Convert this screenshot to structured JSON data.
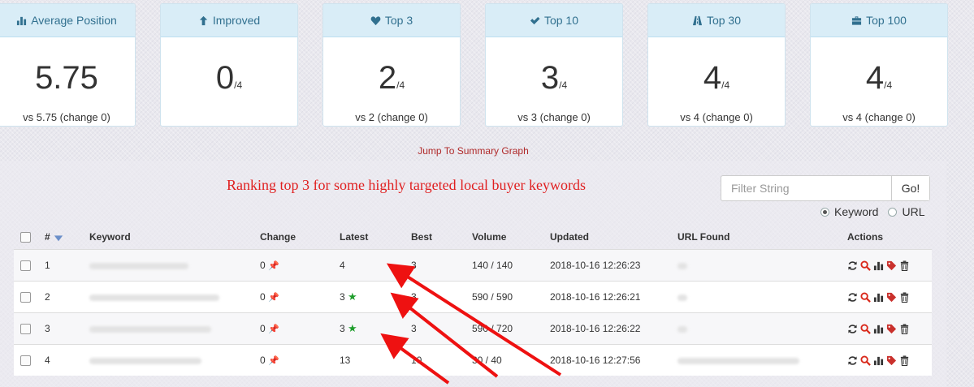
{
  "cards": [
    {
      "label": "Average Position",
      "icon": "bar-chart-icon",
      "value": "5.75",
      "denominator": "",
      "sub": "vs 5.75 (change 0)"
    },
    {
      "label": "Improved",
      "icon": "arrow-up-icon",
      "value": "0",
      "denominator": "/4",
      "sub": ""
    },
    {
      "label": "Top 3",
      "icon": "heart-icon",
      "value": "2",
      "denominator": "/4",
      "sub": "vs 2 (change 0)"
    },
    {
      "label": "Top 10",
      "icon": "check-icon",
      "value": "3",
      "denominator": "/4",
      "sub": "vs 3 (change 0)"
    },
    {
      "label": "Top 30",
      "icon": "road-icon",
      "value": "4",
      "denominator": "/4",
      "sub": "vs 4 (change 0)"
    },
    {
      "label": "Top 100",
      "icon": "briefcase-icon",
      "value": "4",
      "denominator": "/4",
      "sub": "vs 4 (change 0)"
    }
  ],
  "jump_link": "Jump To Summary Graph",
  "headline": "Ranking top 3 for some highly targeted local buyer keywords",
  "filter": {
    "placeholder": "Filter String",
    "button": "Go!"
  },
  "radio": {
    "keyword": "Keyword",
    "url": "URL",
    "selected": "keyword"
  },
  "table": {
    "headers": {
      "num": "#",
      "keyword": "Keyword",
      "change": "Change",
      "latest": "Latest",
      "best": "Best",
      "volume": "Volume",
      "updated": "Updated",
      "url": "URL Found",
      "actions": "Actions"
    },
    "rows": [
      {
        "num": "1",
        "change": "0",
        "latest": "4",
        "star": false,
        "best": "3",
        "volume": "140 / 140",
        "updated": "2018-10-16 12:26:23"
      },
      {
        "num": "2",
        "change": "0",
        "latest": "3",
        "star": true,
        "best": "3",
        "volume": "590 / 590",
        "updated": "2018-10-16 12:26:21"
      },
      {
        "num": "3",
        "change": "0",
        "latest": "3",
        "star": true,
        "best": "3",
        "volume": "590 / 720",
        "updated": "2018-10-16 12:26:22"
      },
      {
        "num": "4",
        "change": "0",
        "latest": "13",
        "star": false,
        "best": "10",
        "volume": "30 / 40",
        "updated": "2018-10-16 12:27:56"
      }
    ]
  },
  "colors": {
    "accent": "#31708f",
    "headline": "#e02020",
    "arrow": "#ee1111",
    "star": "#1e9d2b"
  }
}
